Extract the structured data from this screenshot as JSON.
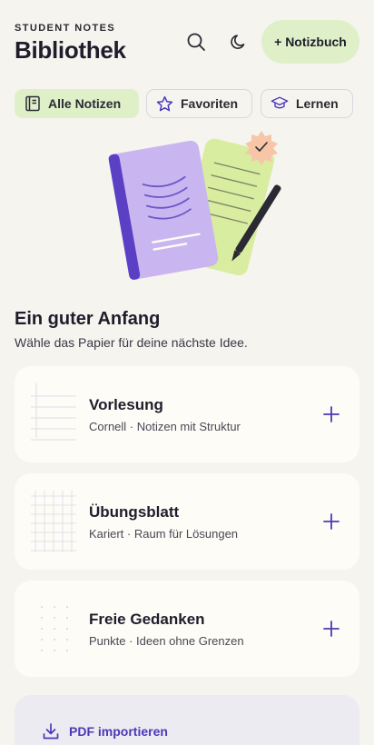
{
  "header": {
    "eyebrow": "STUDENT NOTES",
    "title": "Bibliothek",
    "new_button_label": "+ Notizbuch"
  },
  "icons": {
    "search": "search-icon",
    "theme": "moon-icon"
  },
  "tabs": [
    {
      "label": "Alle Notizen",
      "icon": "notebook-icon",
      "active": true
    },
    {
      "label": "Favoriten",
      "icon": "star-icon",
      "active": false
    },
    {
      "label": "Lernen",
      "icon": "graduation-cap-icon",
      "active": false
    }
  ],
  "section": {
    "title": "Ein guter Anfang",
    "subtitle": "Wähle das Papier für deine nächste Idee."
  },
  "templates": [
    {
      "title": "Vorlesung",
      "subtitle": "Cornell · Notizen mit Struktur",
      "paper": "lined"
    },
    {
      "title": "Übungsblatt",
      "subtitle": "Kariert · Raum für Lösungen",
      "paper": "grid"
    },
    {
      "title": "Freie Gedanken",
      "subtitle": "Punkte · Ideen ohne Grenzen",
      "paper": "dotted"
    }
  ],
  "import": {
    "label": "PDF importieren",
    "icon": "download-icon"
  },
  "colors": {
    "background": "#f5f4ef",
    "accent_green": "#dff0c9",
    "accent_purple": "#4b39b8",
    "notebook_purple": "#c9b6f0",
    "card": "#fdfcf6"
  }
}
